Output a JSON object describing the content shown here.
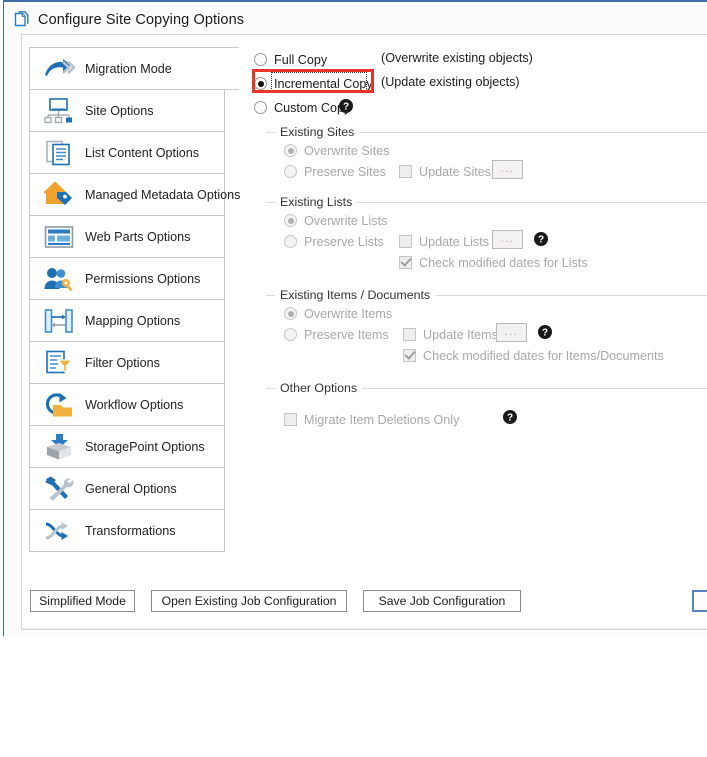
{
  "window": {
    "title": "Configure Site Copying Options",
    "title_icon": "copy-document-icon"
  },
  "sidebar": {
    "items": [
      {
        "label": "Migration Mode",
        "icon": "arrows-right-icon",
        "selected": true
      },
      {
        "label": "Site Options",
        "icon": "site-hierarchy-icon",
        "selected": false
      },
      {
        "label": "List Content Options",
        "icon": "documents-icon",
        "selected": false
      },
      {
        "label": "Managed Metadata Options",
        "icon": "home-tag-icon",
        "selected": false
      },
      {
        "label": "Web Parts Options",
        "icon": "web-part-icon",
        "selected": false
      },
      {
        "label": "Permissions Options",
        "icon": "users-key-icon",
        "selected": false
      },
      {
        "label": "Mapping Options",
        "icon": "mapping-arrows-icon",
        "selected": false
      },
      {
        "label": "Filter Options",
        "icon": "document-filter-icon",
        "selected": false
      },
      {
        "label": "Workflow Options",
        "icon": "workflow-folder-icon",
        "selected": false
      },
      {
        "label": "StoragePoint Options",
        "icon": "box-download-icon",
        "selected": false
      },
      {
        "label": "General Options",
        "icon": "hammer-wrench-icon",
        "selected": false
      },
      {
        "label": "Transformations",
        "icon": "shuffle-arrows-icon",
        "selected": false
      }
    ]
  },
  "mode": {
    "options": [
      {
        "label": "Full Copy",
        "selected": false,
        "note": "(Overwrite existing objects)",
        "help": false
      },
      {
        "label": "Incremental Copy",
        "selected": true,
        "note": "(Update existing objects)",
        "help": false
      },
      {
        "label": "Custom Copy",
        "selected": false,
        "note": "",
        "help": true
      }
    ],
    "highlighted_option": "Incremental Copy"
  },
  "groups": [
    {
      "title": "Existing Sites",
      "radios": [
        {
          "label": "Overwrite Sites",
          "selected": true,
          "disabled": true
        },
        {
          "label": "Preserve Sites",
          "selected": false,
          "disabled": true
        }
      ],
      "checkbox_main": {
        "label": "Update Sites",
        "checked": false,
        "disabled": true
      },
      "dots_button": "...",
      "help": false,
      "checkbox_sub": null
    },
    {
      "title": "Existing Lists",
      "radios": [
        {
          "label": "Overwrite Lists",
          "selected": true,
          "disabled": true
        },
        {
          "label": "Preserve Lists",
          "selected": false,
          "disabled": true
        }
      ],
      "checkbox_main": {
        "label": "Update Lists",
        "checked": false,
        "disabled": true
      },
      "dots_button": "...",
      "help": true,
      "checkbox_sub": {
        "label": "Check modified dates for Lists",
        "checked": true,
        "disabled": true
      }
    },
    {
      "title": "Existing Items / Documents",
      "radios": [
        {
          "label": "Overwrite Items",
          "selected": true,
          "disabled": true
        },
        {
          "label": "Preserve Items",
          "selected": false,
          "disabled": true
        }
      ],
      "checkbox_main": {
        "label": "Update Items",
        "checked": false,
        "disabled": true
      },
      "dots_button": "...",
      "help": true,
      "checkbox_sub": {
        "label": "Check modified dates for Items/Documents",
        "checked": true,
        "disabled": true
      }
    }
  ],
  "other_options": {
    "title": "Other Options",
    "checkbox": {
      "label": "Migrate Item Deletions Only",
      "checked": false,
      "disabled": true
    },
    "help": true
  },
  "buttons": {
    "simplified_mode": "Simplified Mode",
    "open_existing_job": "Open Existing Job Configuration",
    "save_job": "Save Job Configuration",
    "default_button": ""
  },
  "colors": {
    "accent_blue": "#2b7cc6",
    "highlight_red": "#e8352b",
    "title_border": "#3f6fab",
    "default_button_border": "#5b82c0"
  }
}
